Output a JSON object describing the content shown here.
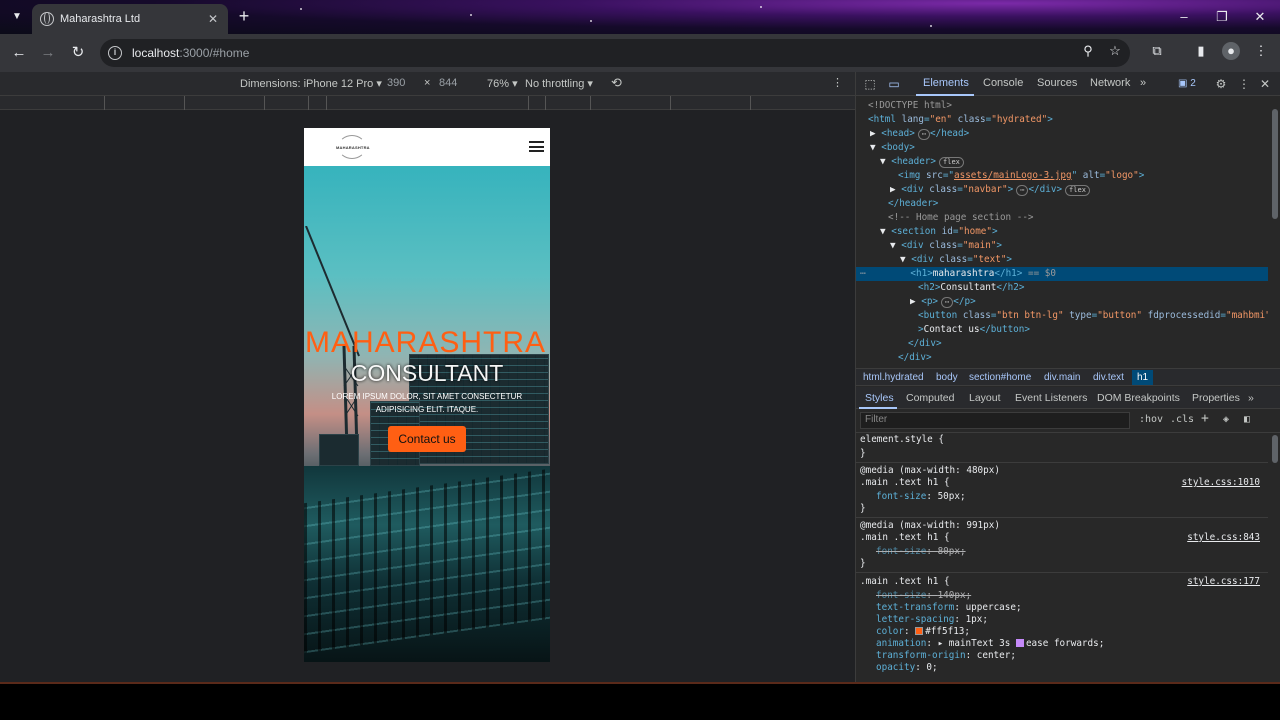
{
  "browser": {
    "tab_title": "Maharashtra Ltd",
    "url_host": "localhost",
    "url_path": ":3000/#home"
  },
  "device_toolbar": {
    "device": "Dimensions: iPhone 12 Pro",
    "width": "390",
    "times": "×",
    "height": "844",
    "zoom": "76%",
    "throttle": "No throttling"
  },
  "site": {
    "logo_text": "MAHARASHTRA",
    "h1": "maharashtra",
    "h2": "Consultant",
    "p": "Lorem ipsum dolor, sit amet consectetur adipisicing elit. Itaque.",
    "button": "Contact us"
  },
  "devtools": {
    "tabs": [
      "Elements",
      "Console",
      "Sources",
      "Network"
    ],
    "issues_count": "2",
    "dom": {
      "doctype": "<!DOCTYPE html>",
      "html_open": "html",
      "html_lang_attr": "lang",
      "html_lang_val": "\"en\"",
      "html_class_attr": "class",
      "html_class_val": "\"hydrated\"",
      "head": "head",
      "body": "body",
      "header": "header",
      "flex": "flex",
      "img": "img",
      "img_src_attr": "src",
      "img_src_val": "assets/mainLogo-3.jpg",
      "img_alt_attr": "alt",
      "img_alt_val": "\"logo\"",
      "div": "div",
      "navbar_val": "\"navbar\"",
      "comment": "<!-- Home page section -->",
      "section": "section",
      "id_attr": "id",
      "home_val": "\"home\"",
      "main_val": "\"main\"",
      "text_val": "\"text\"",
      "h1": "h1",
      "h1_text": "maharashtra",
      "sel_marker": "== $0",
      "h2": "h2",
      "h2_text": "Consultant",
      "p": "p",
      "button": "button",
      "btn_class_val": "\"btn btn-lg\"",
      "type_attr": "type",
      "type_val": "\"button\"",
      "fdp_attr": "fdprocessedid",
      "fdp_val": "\"mahbmi\"",
      "btn_text": "Contact us"
    },
    "breadcrumbs": [
      "html.hydrated",
      "body",
      "section#home",
      "div.main",
      "div.text",
      "h1"
    ],
    "style_tabs": [
      "Styles",
      "Computed",
      "Layout",
      "Event Listeners",
      "DOM Breakpoints",
      "Properties"
    ],
    "filter_placeholder": "Filter",
    "hov": ":hov",
    "cls": ".cls",
    "styles": {
      "element_style": "element.style {",
      "close": "}",
      "media1": "@media (max-width: 480px)",
      "rule1_selector": ".main .text h1 {",
      "rule1_src": "style.css:1010",
      "rule1_prop": "font-size",
      "rule1_val": "50px;",
      "media2": "@media (max-width: 991px)",
      "rule2_selector": ".main .text h1 {",
      "rule2_src": "style.css:843",
      "rule2_prop": "font-size",
      "rule2_val": "80px;",
      "rule3_selector": ".main .text h1 {",
      "rule3_src": "style.css:177",
      "p1": "font-size",
      "v1": "140px;",
      "p2": "text-transform",
      "v2": "uppercase;",
      "p3": "letter-spacing",
      "v3": "1px;",
      "p4": "color",
      "v4": "#ff5f13;",
      "p5": "animation",
      "v5a": "mainText 3s",
      "v5b": "ease forwards;",
      "p6": "transform-origin",
      "v6": "center;",
      "p7": "opacity",
      "v7": "0;"
    }
  },
  "colors": {
    "accent": "#ff5f13",
    "devtools_blue": "#a8c7fa"
  }
}
